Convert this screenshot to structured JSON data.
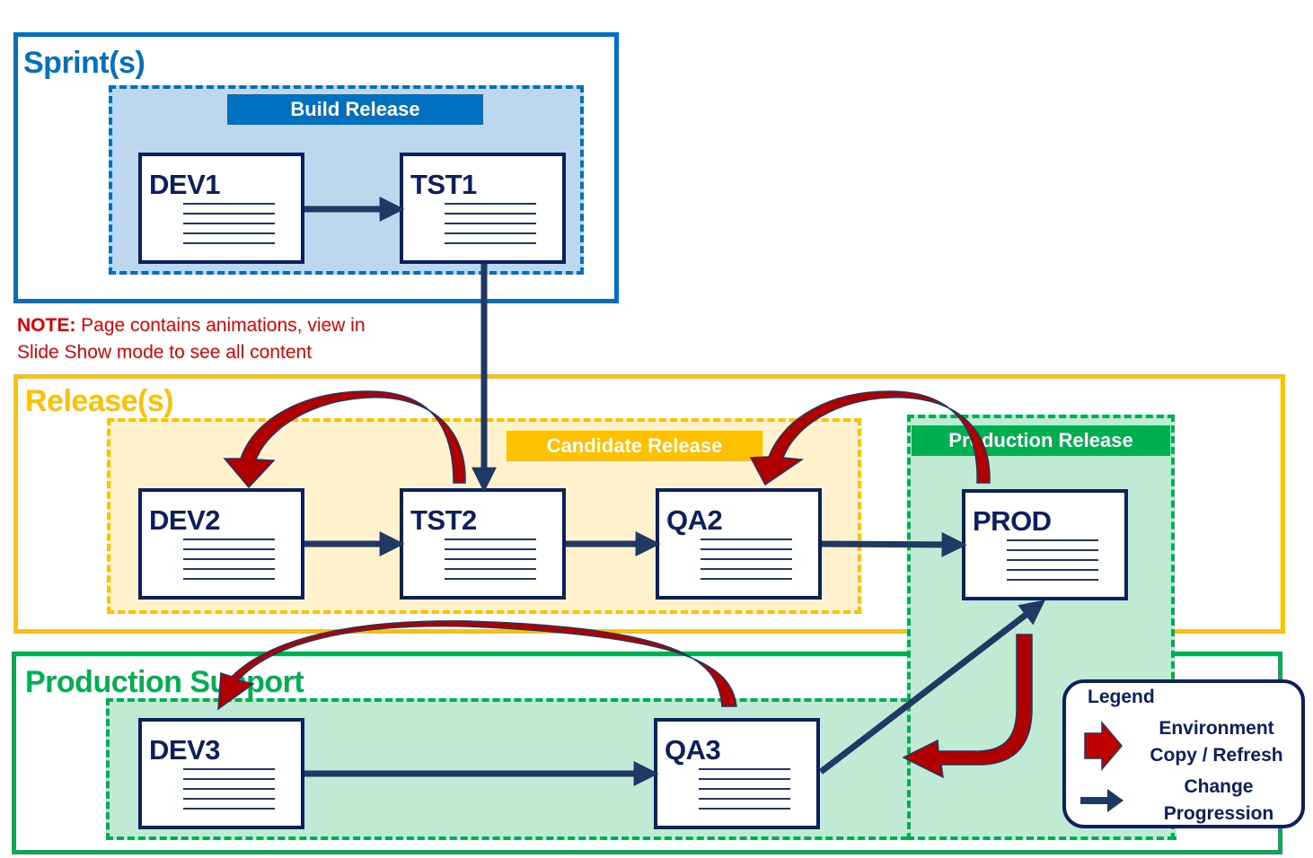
{
  "sections": {
    "sprints": {
      "title": "Sprint(s)",
      "color": "#0070c0"
    },
    "releases": {
      "title": "Release(s)",
      "color": "#ffc000"
    },
    "production_support": {
      "title": "Production Support",
      "color": "#00b050"
    }
  },
  "zones": {
    "build_release": {
      "label": "Build Release",
      "band_color": "#0070c0",
      "fill": "#bdd7ee"
    },
    "candidate_release": {
      "label": "Candidate Release",
      "band_color": "#ffc000",
      "fill": "#fff2cc"
    },
    "production_release": {
      "label": "Production Release",
      "band_color": "#00b050",
      "fill": "#c0ead4"
    },
    "production_support_zone": {
      "fill": "#c0ead4"
    }
  },
  "environments": {
    "dev1": "DEV1",
    "tst1": "TST1",
    "dev2": "DEV2",
    "tst2": "TST2",
    "qa2": "QA2",
    "prod": "PROD",
    "dev3": "DEV3",
    "qa3": "QA3"
  },
  "note": {
    "prefix": "NOTE:",
    "line1": " Page contains animations, view in",
    "line2": "Slide Show mode to see all content",
    "color": "#e00000"
  },
  "legend": {
    "title": "Legend",
    "copy_label_line1": "Environment",
    "copy_label_line2": "Copy / Refresh",
    "change_label_line1": "Change",
    "change_label_line2": "Progression",
    "copy_color": "#c00000",
    "change_color": "#1f3864"
  },
  "flows": {
    "change_progression": [
      [
        "DEV1",
        "TST1"
      ],
      [
        "TST1",
        "TST2"
      ],
      [
        "DEV2",
        "TST2"
      ],
      [
        "TST2",
        "QA2"
      ],
      [
        "QA2",
        "PROD"
      ],
      [
        "DEV3",
        "QA3"
      ],
      [
        "QA3",
        "PROD"
      ]
    ],
    "environment_copy": [
      [
        "TST2",
        "DEV2"
      ],
      [
        "PROD",
        "QA2"
      ],
      [
        "QA3",
        "DEV3"
      ],
      [
        "PROD",
        "Production Support"
      ]
    ]
  }
}
